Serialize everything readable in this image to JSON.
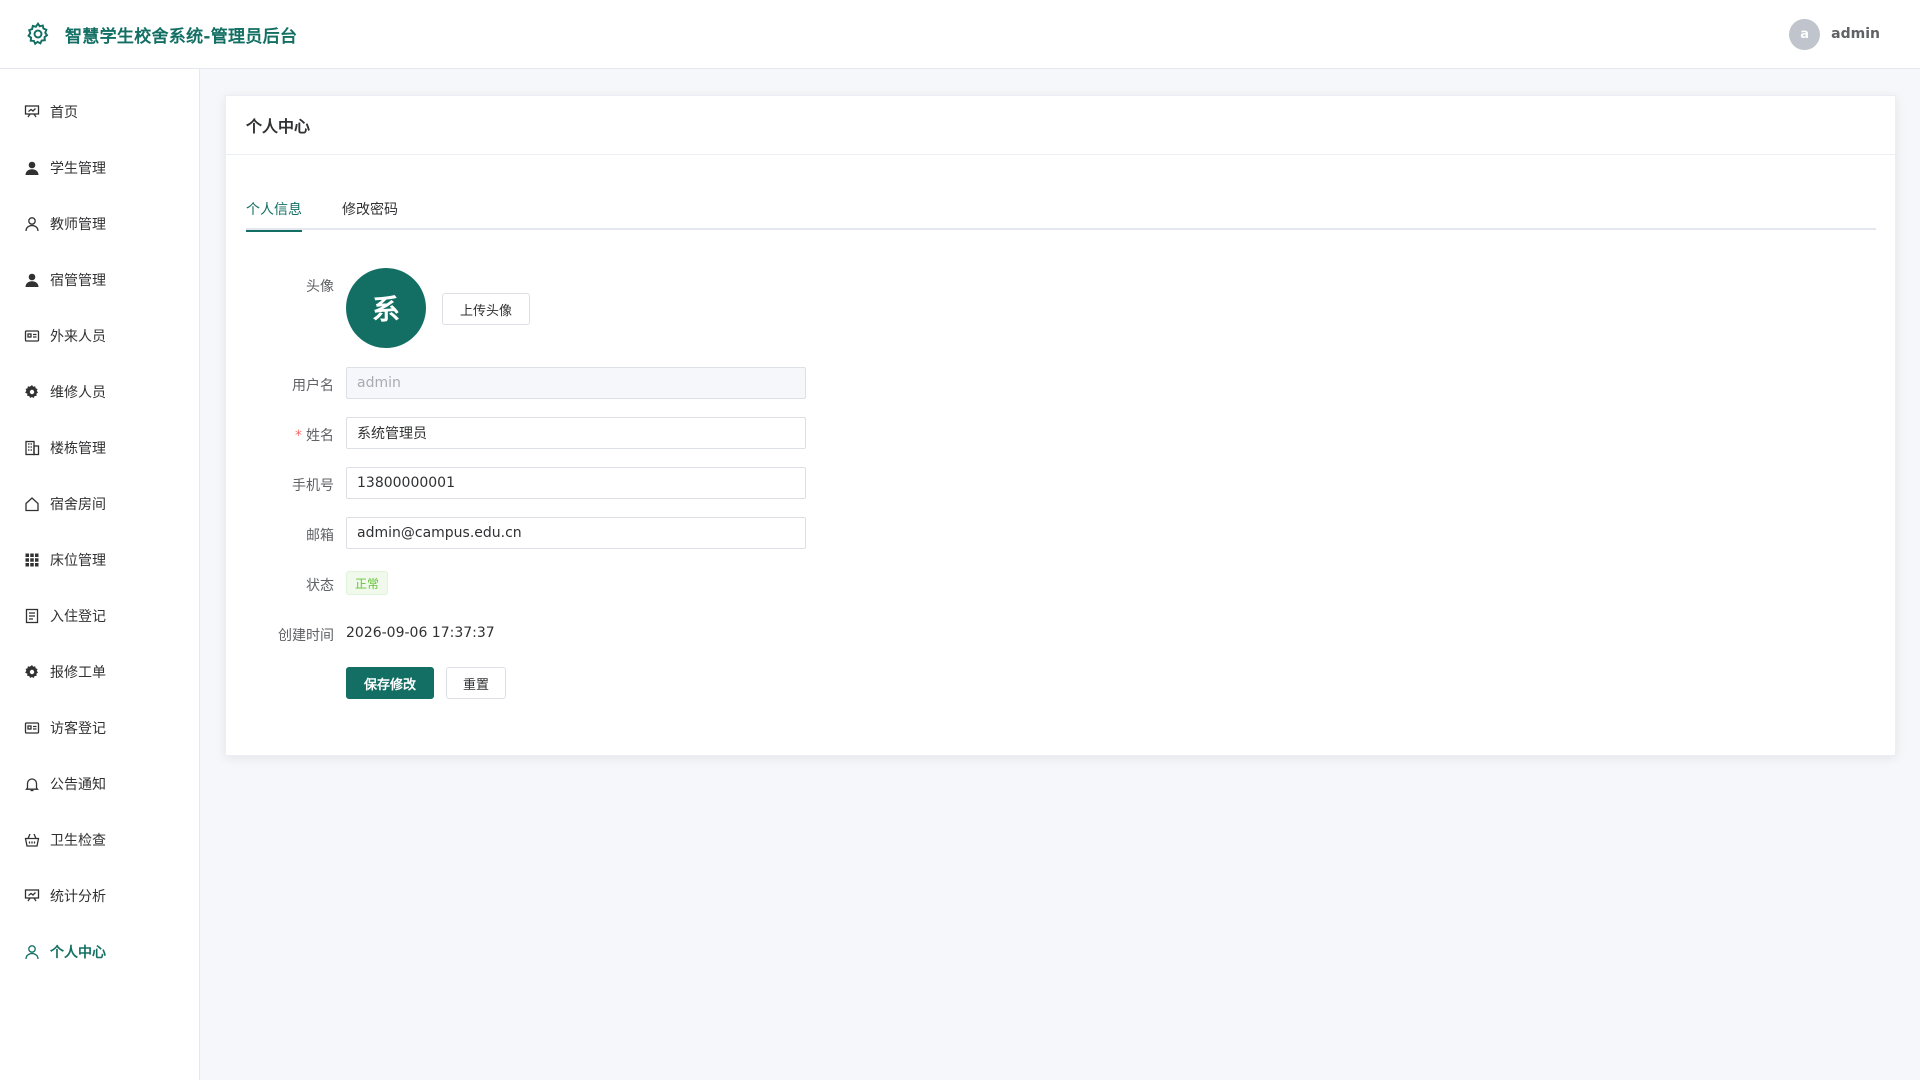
{
  "header": {
    "title": "智慧学生校舍系统-管理员后台",
    "user_initial": "a",
    "username": "admin"
  },
  "sidebar": {
    "items": [
      {
        "label": "首页",
        "icon": "presentation-icon"
      },
      {
        "label": "学生管理",
        "icon": "user-filled-icon"
      },
      {
        "label": "教师管理",
        "icon": "user-icon"
      },
      {
        "label": "宿管管理",
        "icon": "user-filled-icon"
      },
      {
        "label": "外来人员",
        "icon": "id-card-icon"
      },
      {
        "label": "维修人员",
        "icon": "gear-filled-icon"
      },
      {
        "label": "楼栋管理",
        "icon": "building-icon"
      },
      {
        "label": "宿舍房间",
        "icon": "house-icon"
      },
      {
        "label": "床位管理",
        "icon": "grid-icon"
      },
      {
        "label": "入住登记",
        "icon": "document-icon"
      },
      {
        "label": "报修工单",
        "icon": "gear-filled-icon"
      },
      {
        "label": "访客登记",
        "icon": "id-card-icon"
      },
      {
        "label": "公告通知",
        "icon": "bell-icon"
      },
      {
        "label": "卫生检查",
        "icon": "basket-icon"
      },
      {
        "label": "统计分析",
        "icon": "presentation-icon"
      },
      {
        "label": "个人中心",
        "icon": "user-icon",
        "active": true
      }
    ]
  },
  "card": {
    "title": "个人中心"
  },
  "tabs": [
    {
      "label": "个人信息",
      "active": true
    },
    {
      "label": "修改密码"
    }
  ],
  "form": {
    "avatar_label": "头像",
    "avatar_text": "系",
    "upload_label": "上传头像",
    "username_label": "用户名",
    "username_value": "admin",
    "name_label": "姓名",
    "name_required": "*",
    "name_value": "系统管理员",
    "phone_label": "手机号",
    "phone_value": "13800000001",
    "email_label": "邮箱",
    "email_value": "admin@campus.edu.cn",
    "status_label": "状态",
    "status_value": "正常",
    "created_label": "创建时间",
    "created_value": "2026-09-06 17:37:37",
    "save_label": "保存修改",
    "reset_label": "重置"
  },
  "colors": {
    "accent": "#136f63",
    "success": "#67c23a",
    "required": "#f56c6c"
  }
}
